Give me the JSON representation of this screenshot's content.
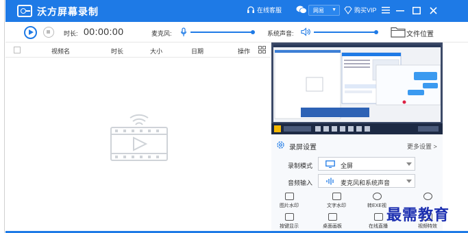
{
  "app": {
    "title": "沃方屏幕录制"
  },
  "titlebar": {
    "support_label": "在线客服",
    "net_select": "网易",
    "buy_vip_label": "购买VIP",
    "controls": [
      "menu-icon",
      "minimize-icon",
      "maximize-icon",
      "close-icon"
    ]
  },
  "toolbar": {
    "duration_label": "时长:",
    "duration_value": "00:00:00",
    "mic_label": "麦克风:",
    "mic_level": 0.95,
    "system_sound_label": "系统声音:",
    "system_sound_level": 0.95,
    "file_location_label": "文件位置"
  },
  "list": {
    "columns": [
      "视频名",
      "时长",
      "大小",
      "日期",
      "操作"
    ],
    "rows": []
  },
  "settings": {
    "title": "录屏设置",
    "more_label": "更多设置 >",
    "record_mode_label": "录制模式",
    "record_mode_value": "全屏",
    "audio_input_label": "音频输入",
    "audio_input_value": "麦克风和系统声音",
    "tools": [
      {
        "label": "图片水印",
        "icon": "image-watermark-icon"
      },
      {
        "label": "文字水印",
        "icon": "text-watermark-icon"
      },
      {
        "label": "转EXE视",
        "icon": "exe-convert-icon"
      },
      {
        "label": "",
        "icon": "timer-icon"
      },
      {
        "label": "按键显示",
        "icon": "keyboard-icon"
      },
      {
        "label": "桌面画板",
        "icon": "drawing-board-icon"
      },
      {
        "label": "在线直播",
        "icon": "live-stream-icon"
      },
      {
        "label": "视频特效",
        "icon": "video-effects-icon"
      }
    ]
  },
  "watermark": {
    "text": "最需教育"
  },
  "colors": {
    "accent": "#1e7ae6",
    "watermark": "#1c2fb0",
    "preview_bg": "#3c4a68"
  }
}
